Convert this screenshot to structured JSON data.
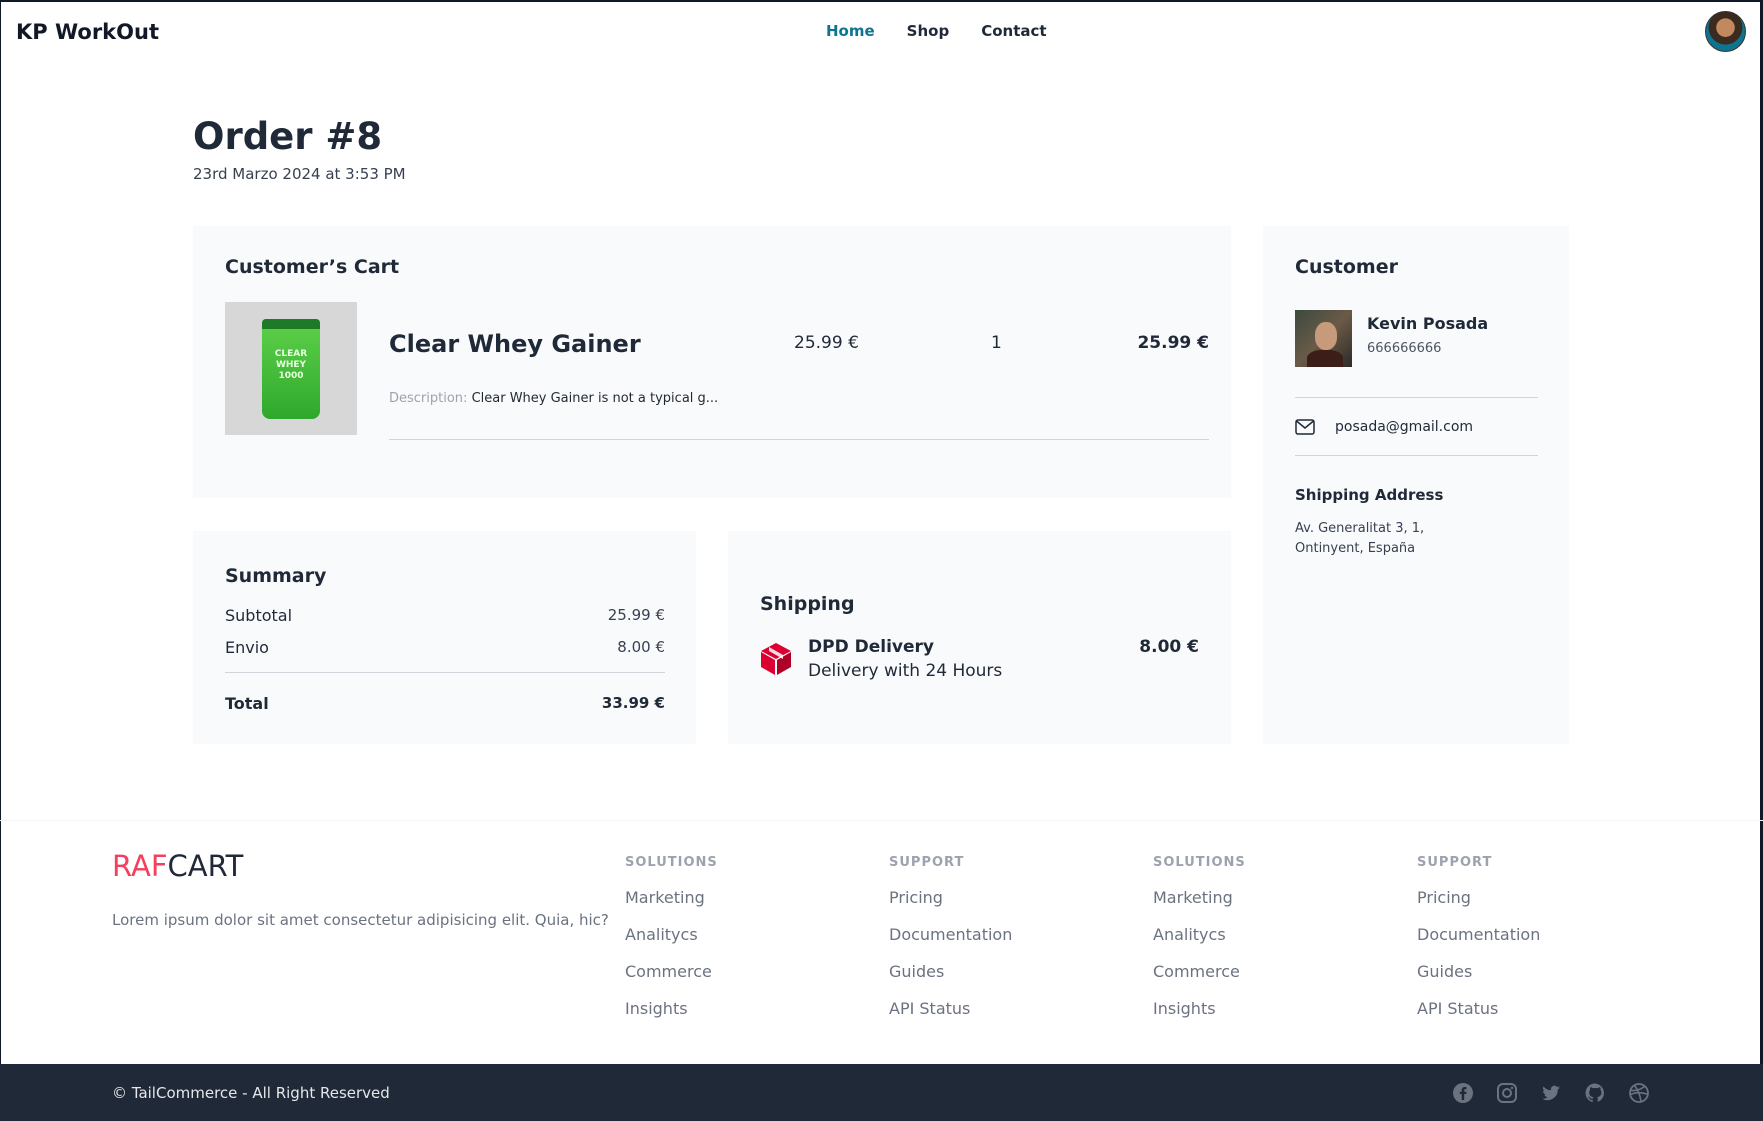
{
  "header": {
    "brand": "KP WorkOut",
    "nav": [
      {
        "label": "Home",
        "active": true
      },
      {
        "label": "Shop",
        "active": false
      },
      {
        "label": "Contact",
        "active": false
      }
    ]
  },
  "order": {
    "title": "Order #8",
    "date": "23rd Marzo 2024 at 3:53 PM"
  },
  "cart": {
    "title": "Customer’s Cart",
    "item": {
      "name": "Clear Whey Gainer",
      "price": "25.99 €",
      "quantity": "1",
      "total": "25.99 €",
      "description_label": "Description:",
      "description": "Clear Whey Gainer is not a typical g..."
    }
  },
  "summary": {
    "title": "Summary",
    "subtotal_label": "Subtotal",
    "subtotal_value": "25.99 €",
    "shipping_label": "Envio",
    "shipping_value": "8.00 €",
    "total_label": "Total",
    "total_value": "33.99 €"
  },
  "shipping": {
    "title": "Shipping",
    "name": "DPD Delivery",
    "description": "Delivery with 24 Hours",
    "price": "8.00 €"
  },
  "customer": {
    "title": "Customer",
    "name": "Kevin Posada",
    "phone": "666666666",
    "email": "posada@gmail.com",
    "address_title": "Shipping Address",
    "address_line1": "Av. Generalitat 3, 1,",
    "address_line2": "Ontinyent, España"
  },
  "footer": {
    "logo_part1": "RAF",
    "logo_part2": "CART",
    "description": "Lorem ipsum dolor sit amet consectetur adipisicing elit. Quia, hic?",
    "columns": [
      {
        "title": "SOLUTIONS",
        "links": [
          "Marketing",
          "Analitycs",
          "Commerce",
          "Insights"
        ]
      },
      {
        "title": "SUPPORT",
        "links": [
          "Pricing",
          "Documentation",
          "Guides",
          "API Status"
        ]
      },
      {
        "title": "SOLUTIONS",
        "links": [
          "Marketing",
          "Analitycs",
          "Commerce",
          "Insights"
        ]
      },
      {
        "title": "SUPPORT",
        "links": [
          "Pricing",
          "Documentation",
          "Guides",
          "API Status"
        ]
      }
    ],
    "copyright": "© TailCommerce - All Right Reserved",
    "social_icons": [
      "facebook-icon",
      "instagram-icon",
      "twitter-icon",
      "github-icon",
      "dribbble-icon"
    ]
  },
  "colors": {
    "accent": "#0e7490",
    "logo_red": "#f43f5e",
    "footer_dark": "#1f2937",
    "panel_bg": "#f9fafb",
    "delivery_red": "#dc0032"
  }
}
